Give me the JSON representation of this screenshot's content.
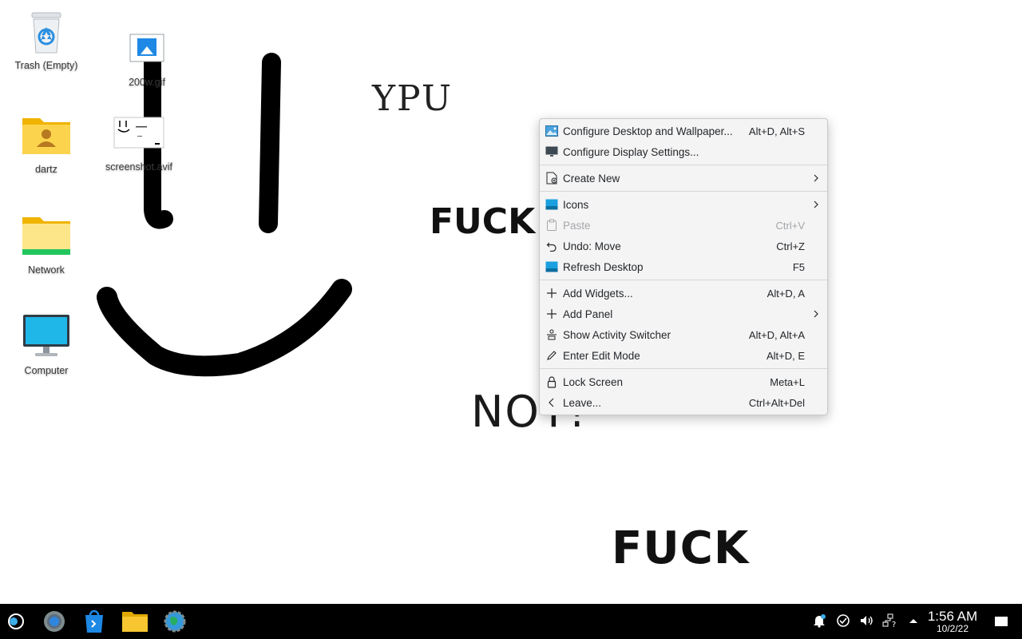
{
  "wallpaper": {
    "texts": [
      "YPU",
      "FUCK",
      "NOT!",
      "FUCK"
    ]
  },
  "desktop_icons": [
    {
      "label": "Trash (Empty)",
      "icon": "trash-icon"
    },
    {
      "label": "200w.gif",
      "icon": "image-file-icon"
    },
    {
      "label": "dartz",
      "icon": "home-folder-icon"
    },
    {
      "label": "screenshot.avif",
      "icon": "image-thumbnail-icon"
    },
    {
      "label": "Network",
      "icon": "network-folder-icon"
    },
    {
      "label": "Computer",
      "icon": "computer-icon"
    }
  ],
  "context_menu": {
    "items": [
      {
        "label": "Configure Desktop and Wallpaper...",
        "shortcut": "Alt+D, Alt+S",
        "icon": "wallpaper-icon"
      },
      {
        "label": "Configure Display Settings...",
        "shortcut": "",
        "icon": "display-icon"
      },
      {
        "label": "Create New",
        "shortcut": "",
        "icon": "create-new-icon",
        "submenu": true
      },
      {
        "label": "Icons",
        "shortcut": "",
        "icon": "icons-icon",
        "submenu": true
      },
      {
        "label": "Paste",
        "shortcut": "Ctrl+V",
        "icon": "paste-icon",
        "disabled": true
      },
      {
        "label": "Undo: Move",
        "shortcut": "Ctrl+Z",
        "icon": "undo-icon"
      },
      {
        "label": "Refresh Desktop",
        "shortcut": "F5",
        "icon": "refresh-icon"
      },
      {
        "label": "Add Widgets...",
        "shortcut": "Alt+D, A",
        "icon": "plus-icon"
      },
      {
        "label": "Add Panel",
        "shortcut": "",
        "icon": "plus-icon",
        "submenu": true
      },
      {
        "label": "Show Activity Switcher",
        "shortcut": "Alt+D, Alt+A",
        "icon": "activity-icon"
      },
      {
        "label": "Enter Edit Mode",
        "shortcut": "Alt+D, E",
        "icon": "pencil-icon"
      },
      {
        "label": "Lock Screen",
        "shortcut": "Meta+L",
        "icon": "lock-icon"
      },
      {
        "label": "Leave...",
        "shortcut": "Ctrl+Alt+Del",
        "icon": "chevron-left-icon"
      }
    ]
  },
  "taskbar": {
    "launchers": [
      "app-launcher-icon",
      "settings-app-icon",
      "discover-store-icon",
      "file-manager-icon",
      "browser-icon"
    ],
    "tray": [
      "notifications-icon",
      "updates-icon",
      "volume-icon",
      "network-icon",
      "expand-tray-icon"
    ],
    "clock": {
      "time": "1:56 AM",
      "date": "10/2/22"
    }
  },
  "colors": {
    "accent": "#3daee9",
    "menu_bg": "#f4f4f5",
    "taskbar_bg": "#000000"
  }
}
